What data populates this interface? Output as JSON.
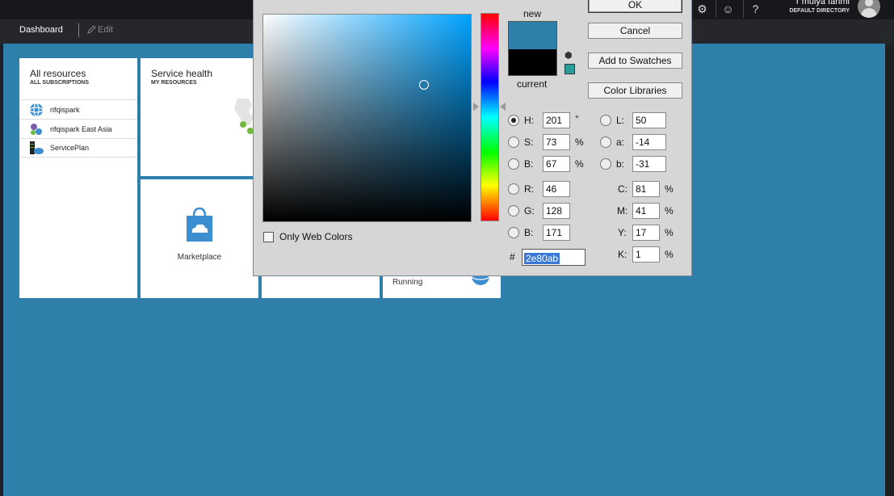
{
  "topbar": {
    "user_name": "r mulya fahmi",
    "user_directory": "DEFAULT DIRECTORY",
    "icons": [
      "gear-icon",
      "smiley-icon",
      "help-icon"
    ]
  },
  "subbar": {
    "dashboard_label": "Dashboard",
    "edit_label": "Edit"
  },
  "tiles": {
    "all_resources": {
      "title": "All resources",
      "subtitle": "ALL SUBSCRIPTIONS",
      "items": [
        {
          "label": "rifqispark",
          "icon": "web-app-icon"
        },
        {
          "label": "rifqispark East Asia",
          "icon": "app-service-icon"
        },
        {
          "label": "ServicePlan",
          "icon": "service-plan-icon"
        }
      ]
    },
    "service_health": {
      "title": "Service health",
      "subtitle": "MY RESOURCES"
    },
    "marketplace": {
      "label": "Marketplace"
    },
    "running": {
      "label": "Running"
    }
  },
  "picker": {
    "new_label": "new",
    "current_label": "current",
    "new_color": "#2e80ab",
    "current_color": "#000000",
    "buttons": {
      "ok": "OK",
      "cancel": "Cancel",
      "add_swatches": "Add to Swatches",
      "color_libraries": "Color Libraries"
    },
    "only_web_colors": "Only Web Colors",
    "hsb": {
      "h_label": "H:",
      "h": "201",
      "h_unit": "°",
      "s_label": "S:",
      "s": "73",
      "s_unit": "%",
      "b_label": "B:",
      "b": "67",
      "b_unit": "%"
    },
    "rgb": {
      "r_label": "R:",
      "r": "46",
      "g_label": "G:",
      "g": "128",
      "b_label": "B:",
      "b": "171"
    },
    "lab": {
      "l_label": "L:",
      "l": "50",
      "a_label": "a:",
      "a": "-14",
      "b_label": "b:",
      "b": "-31"
    },
    "cmyk": {
      "c_label": "C:",
      "c": "81",
      "m_label": "M:",
      "m": "41",
      "y_label": "Y:",
      "y": "17",
      "k_label": "K:",
      "k": "1",
      "unit": "%"
    },
    "hex_label": "#",
    "hex": "2e80ab"
  }
}
